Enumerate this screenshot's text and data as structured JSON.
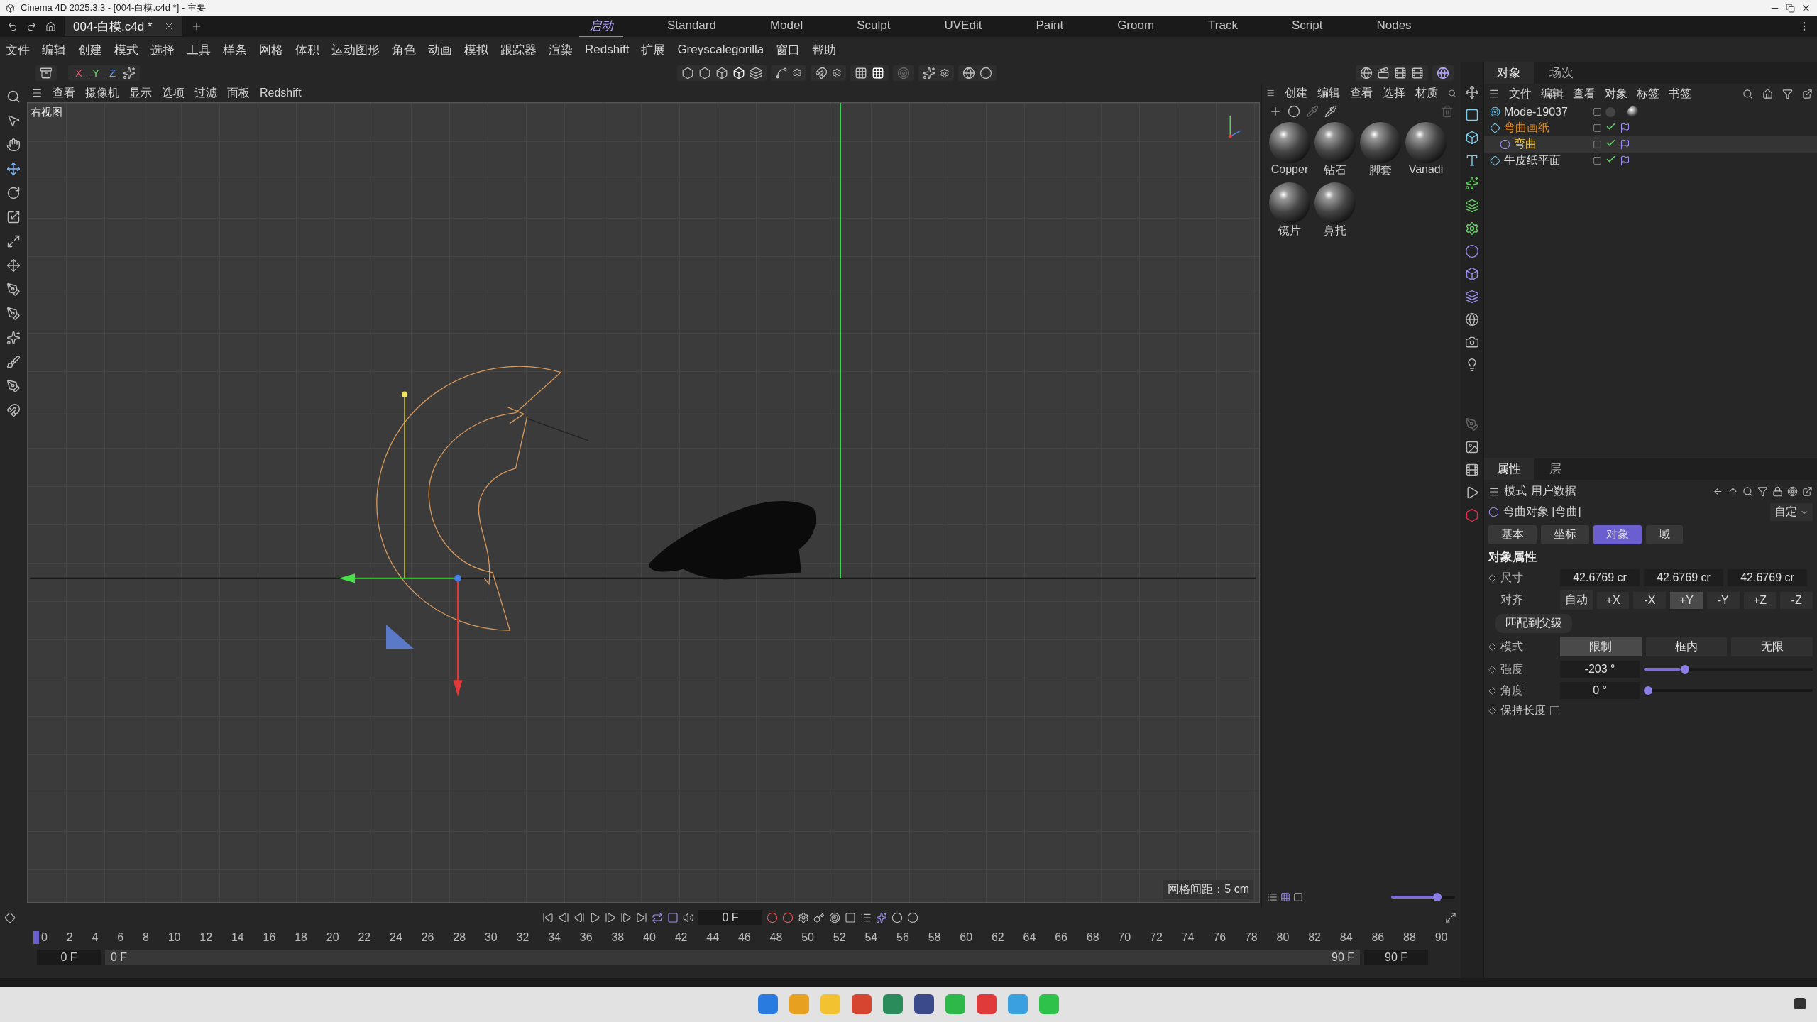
{
  "window": {
    "title": "Cinema 4D 2025.3.3 - [004-白模.c4d *] - 主要"
  },
  "document_tabs": [
    {
      "label": "004-白模.c4d *",
      "selected": true
    }
  ],
  "layouts": [
    {
      "label": "启动",
      "selected": true
    },
    {
      "label": "Standard",
      "selected": false
    },
    {
      "label": "Model",
      "selected": false
    },
    {
      "label": "Sculpt",
      "selected": false
    },
    {
      "label": "UVEdit",
      "selected": false
    },
    {
      "label": "Paint",
      "selected": false
    },
    {
      "label": "Groom",
      "selected": false
    },
    {
      "label": "Track",
      "selected": false
    },
    {
      "label": "Script",
      "selected": false
    },
    {
      "label": "Nodes",
      "selected": false
    }
  ],
  "menu": [
    "文件",
    "编辑",
    "创建",
    "模式",
    "选择",
    "工具",
    "样条",
    "网格",
    "体积",
    "运动图形",
    "角色",
    "动画",
    "模拟",
    "跟踪器",
    "渲染",
    "Redshift",
    "扩展",
    "Greyscalegorilla",
    "窗口",
    "帮助"
  ],
  "axis_toggles": [
    "X",
    "Y",
    "Z"
  ],
  "viewport": {
    "menu": [
      "查看",
      "摄像机",
      "显示",
      "选项",
      "过滤",
      "面板",
      "Redshift"
    ],
    "view_name": "右视图",
    "grid_spacing": "网格间距：5 cm"
  },
  "materials": {
    "menu": [
      "创建",
      "编辑",
      "查看",
      "选择",
      "材质"
    ],
    "items": [
      {
        "name": "Copper"
      },
      {
        "name": "钻石"
      },
      {
        "name": "脚套"
      },
      {
        "name": "Vanadi"
      },
      {
        "name": "镜片"
      },
      {
        "name": "鼻托"
      }
    ],
    "zoom": {
      "level": 0.72
    }
  },
  "objects": {
    "tabs": [
      {
        "label": "对象",
        "selected": true
      },
      {
        "label": "场次",
        "selected": false
      }
    ],
    "menu": [
      "文件",
      "编辑",
      "查看",
      "对象",
      "标签",
      "书签"
    ],
    "tree": [
      {
        "name": "Mode-19037",
        "kind": "null",
        "selected": false,
        "enabled": false,
        "color": "#dddddd"
      },
      {
        "name": "弯曲画纸",
        "kind": "plane",
        "selected": false,
        "enabled": true,
        "color": "#e0902a",
        "children": [
          {
            "name": "弯曲",
            "kind": "bend",
            "selected": true,
            "enabled": true,
            "color": "#f2c744"
          }
        ]
      },
      {
        "name": "牛皮纸平面",
        "kind": "plane",
        "selected": false,
        "enabled": true,
        "color": "#dddddd"
      }
    ]
  },
  "attributes": {
    "tabs": [
      {
        "label": "属性",
        "selected": true
      },
      {
        "label": "层",
        "selected": false
      }
    ],
    "menu": [
      "模式",
      "用户数据"
    ],
    "object_title": "弯曲对象 [弯曲]",
    "preset": "自定",
    "pages": [
      {
        "label": "基本",
        "selected": false
      },
      {
        "label": "坐标",
        "selected": false
      },
      {
        "label": "对象",
        "selected": true
      },
      {
        "label": "域",
        "selected": false
      }
    ],
    "section": "对象属性",
    "size": {
      "label": "尺寸",
      "values": [
        "42.6769 cr",
        "42.6769 cr",
        "42.6769 cr"
      ]
    },
    "align": {
      "label": "对齐",
      "options": [
        {
          "label": "自动",
          "selected": false
        },
        {
          "label": "+X",
          "selected": false
        },
        {
          "label": "-X",
          "selected": false
        },
        {
          "label": "+Y",
          "selected": true
        },
        {
          "label": "-Y",
          "selected": false
        },
        {
          "label": "+Z",
          "selected": false
        },
        {
          "label": "-Z",
          "selected": false
        }
      ]
    },
    "match_button": "匹配到父级",
    "mode": {
      "label": "模式",
      "options": [
        {
          "label": "限制",
          "selected": true
        },
        {
          "label": "框内",
          "selected": false
        },
        {
          "label": "无限",
          "selected": false
        }
      ]
    },
    "strength": {
      "label": "强度",
      "value": "-203 °",
      "level": 0.22
    },
    "angle": {
      "label": "角度",
      "value": "0 °",
      "level": 0
    },
    "keep_length": {
      "label": "保持长度",
      "checked": false
    }
  },
  "timeline": {
    "current_frame": "0 F",
    "ticks": [
      "0",
      "2",
      "4",
      "6",
      "8",
      "10",
      "12",
      "14",
      "16",
      "18",
      "20",
      "22",
      "24",
      "26",
      "28",
      "30",
      "32",
      "34",
      "36",
      "38",
      "40",
      "42",
      "44",
      "46",
      "48",
      "50",
      "52",
      "54",
      "56",
      "58",
      "60",
      "62",
      "64",
      "66",
      "68",
      "70",
      "72",
      "74",
      "76",
      "78",
      "80",
      "82",
      "84",
      "86",
      "88",
      "90"
    ],
    "range": {
      "start": "0 F",
      "min": "0 F",
      "max": "90 F",
      "end": "90 F"
    }
  }
}
